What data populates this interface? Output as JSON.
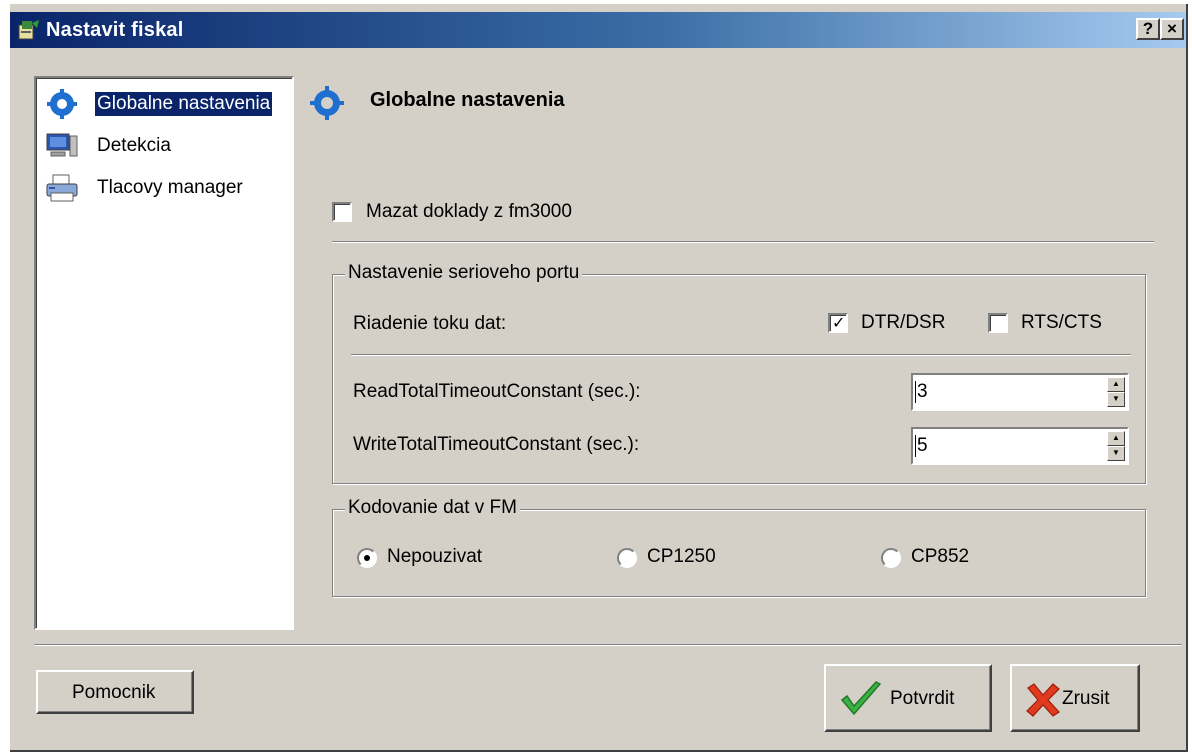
{
  "window": {
    "title": "Nastavit fiskal",
    "help_glyph": "?",
    "close_glyph": "×",
    "app_icon": "app-icon"
  },
  "nav": {
    "items": [
      {
        "label": "Globalne nastavenia",
        "icon": "gear-icon",
        "selected": true
      },
      {
        "label": "Detekcia",
        "icon": "computer-icon",
        "selected": false
      },
      {
        "label": "Tlacovy manager",
        "icon": "printer-icon",
        "selected": false
      }
    ]
  },
  "main": {
    "title": "Globalne nastavenia",
    "title_icon": "gear-icon",
    "delete_docs": {
      "label": "Mazat doklady z fm3000",
      "checked": false
    },
    "serial_group": {
      "title": "Nastavenie serioveho portu",
      "flow_label": "Riadenie toku dat:",
      "dtr_dsr": {
        "label": "DTR/DSR",
        "checked": true
      },
      "rts_cts": {
        "label": "RTS/CTS",
        "checked": false
      },
      "read_timeout": {
        "label": "ReadTotalTimeoutConstant (sec.):",
        "value": "3"
      },
      "write_timeout": {
        "label": "WriteTotalTimeoutConstant (sec.):",
        "value": "5"
      }
    },
    "encoding_group": {
      "title": "Kodovanie dat v FM",
      "options": [
        {
          "label": "Nepouzivat",
          "selected": true
        },
        {
          "label": "CP1250",
          "selected": false
        },
        {
          "label": "CP852",
          "selected": false
        }
      ]
    }
  },
  "footer": {
    "help_label": "Pomocnik",
    "confirm_label": "Potvrdit",
    "cancel_label": "Zrusit"
  },
  "colors": {
    "title_gradient_start": "#0a246a",
    "title_gradient_end": "#a6caf0",
    "face": "#d4d0c8",
    "selection": "#0a246a",
    "confirm_icon": "#3cb043",
    "cancel_icon": "#e03a1e"
  }
}
